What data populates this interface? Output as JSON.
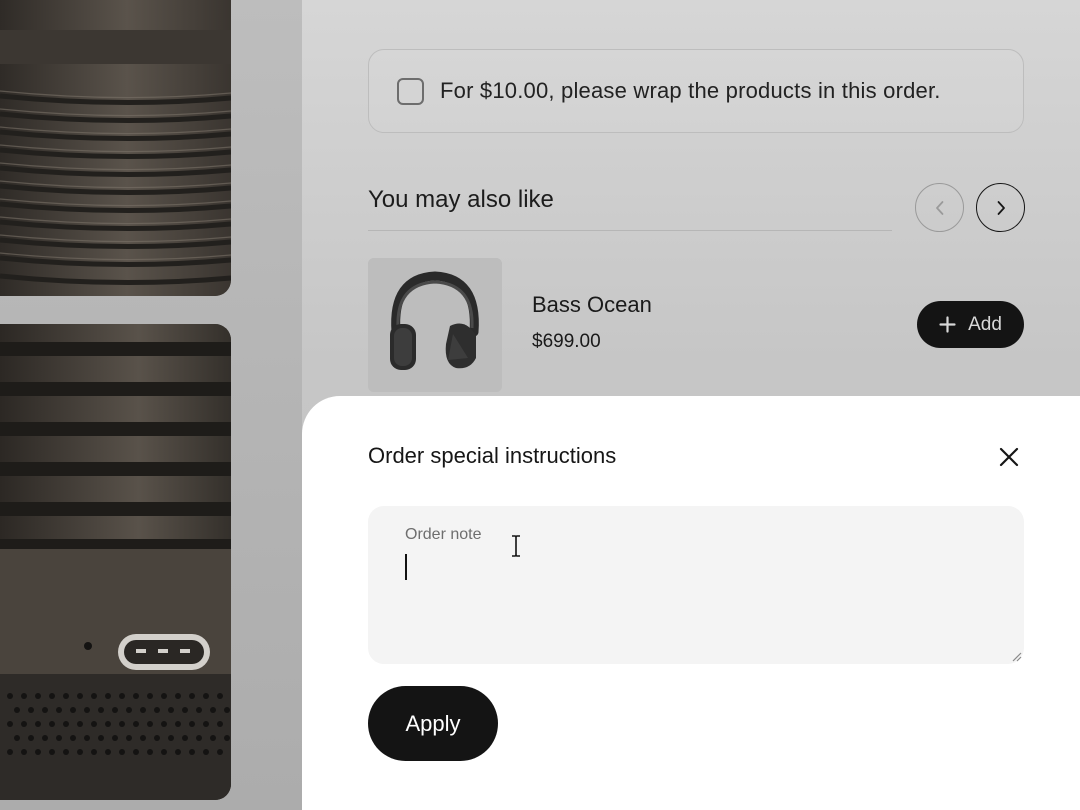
{
  "gift_wrap": {
    "label": "For $10.00, please wrap the products in this order.",
    "checked": false
  },
  "recommendations": {
    "title": "You may also like",
    "prev_icon": "chevron-left-icon",
    "next_icon": "chevron-right-icon",
    "product": {
      "name": "Bass Ocean",
      "price": "$699.00",
      "add_label": "Add",
      "add_icon": "plus-icon"
    }
  },
  "drawer": {
    "title": "Order special instructions",
    "close_icon": "close-icon",
    "note": {
      "label": "Order note",
      "value": ""
    },
    "apply_label": "Apply"
  },
  "colors": {
    "button_dark": "#141414",
    "field_bg": "#f4f4f4",
    "drawer_bg": "#ffffff"
  }
}
